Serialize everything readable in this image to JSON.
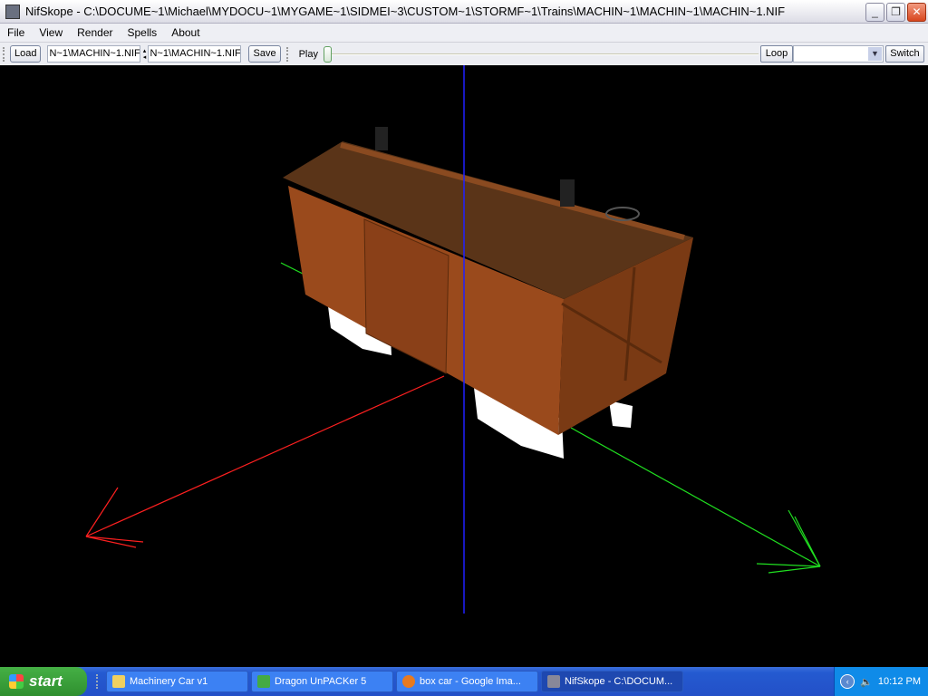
{
  "window": {
    "title": "NifSkope - C:\\DOCUME~1\\Michael\\MYDOCU~1\\MYGAME~1\\SIDMEI~3\\CUSTOM~1\\STORMF~1\\Trains\\MACHIN~1\\MACHIN~1\\MACHIN~1.NIF",
    "minimize": "_",
    "restore": "❐",
    "close": "✕"
  },
  "menu": [
    "File",
    "View",
    "Render",
    "Spells",
    "About"
  ],
  "toolbar": {
    "load": "Load",
    "load_path": "N~1\\MACHIN~1.NIF",
    "save_path": "N~1\\MACHIN~1.NIF",
    "save": "Save",
    "play": "Play",
    "animation_position": 0,
    "loop": "Loop",
    "sequence": "",
    "switch": "Switch"
  },
  "colors": {
    "x_axis": "#ff2020",
    "y_axis": "#20e020",
    "z_axis": "#2020ff",
    "background": "#000000"
  },
  "taskbar": {
    "start": "start",
    "tasks": [
      "Machinery Car v1",
      "Dragon UnPACKer 5",
      "box car - Google Ima...",
      "NifSkope - C:\\DOCUM..."
    ],
    "clock": "10:12 PM"
  }
}
